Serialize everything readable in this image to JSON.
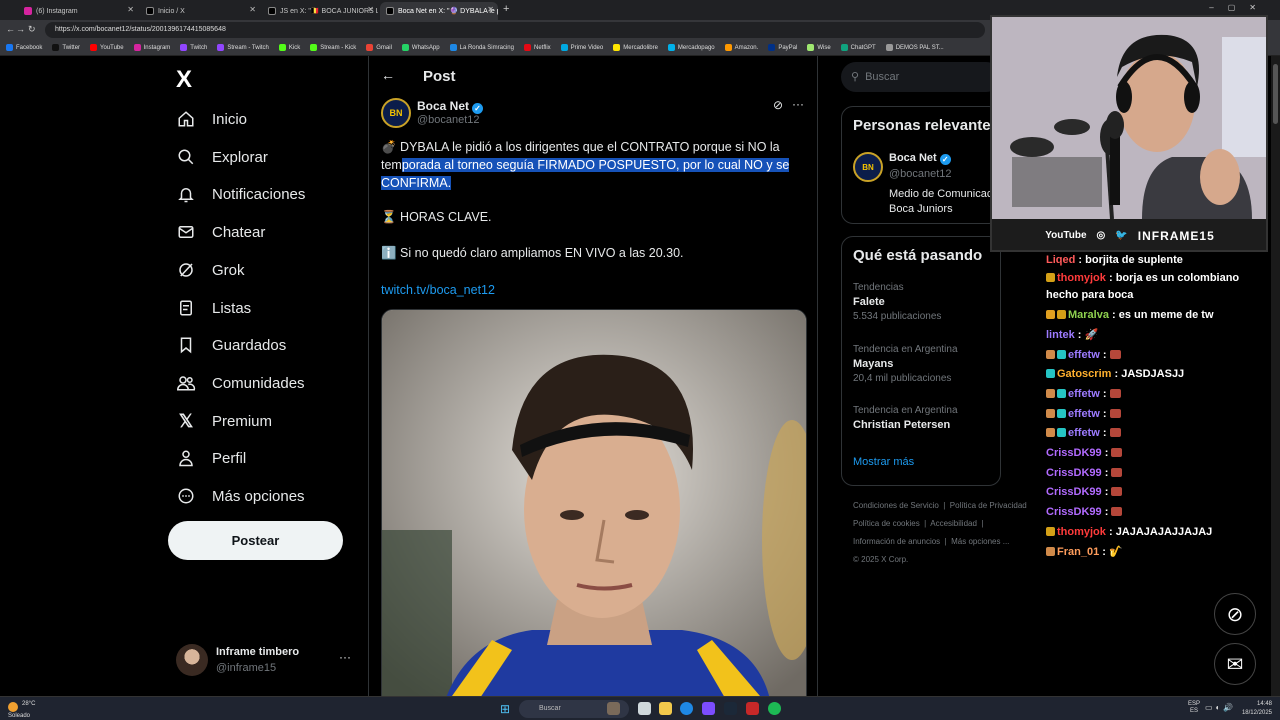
{
  "browser": {
    "tabs": [
      {
        "title": "(6) Instagram",
        "active": false
      },
      {
        "title": "Inicio / X",
        "active": false
      },
      {
        "title": "JS en X: \"🇧🇪 BOCA JUNIORS LE...",
        "active": false
      },
      {
        "title": "Boca Net en X: \"🔮 DYBALA le pi...",
        "active": true
      }
    ],
    "url": "https://x.com/bocanet12/status/2001396174415085648",
    "bookmarks": [
      "Facebook",
      "Twitter",
      "YouTube",
      "Instagram",
      "Twitch",
      "Stream - Twitch",
      "Kick",
      "Stream - Kick",
      "Gmail",
      "WhatsApp",
      "La Ronda Simracing",
      "Netflix",
      "Prime Video",
      "Mercadolibre",
      "Mercadopago",
      "Amazon.",
      "PayPal",
      "Wise",
      "ChatGPT",
      "DEMOS PAL ST..."
    ]
  },
  "nav": {
    "logo": "X",
    "items": [
      {
        "label": "Inicio",
        "icon": "home-icon"
      },
      {
        "label": "Explorar",
        "icon": "search-icon"
      },
      {
        "label": "Notificaciones",
        "icon": "bell-icon"
      },
      {
        "label": "Chatear",
        "icon": "mail-icon"
      },
      {
        "label": "Grok",
        "icon": "grok-icon"
      },
      {
        "label": "Listas",
        "icon": "list-icon"
      },
      {
        "label": "Guardados",
        "icon": "bookmark-icon"
      },
      {
        "label": "Comunidades",
        "icon": "people-icon"
      },
      {
        "label": "Premium",
        "icon": "x-icon"
      },
      {
        "label": "Perfil",
        "icon": "user-icon"
      },
      {
        "label": "Más opciones",
        "icon": "more-circle-icon"
      }
    ],
    "post_button": "Postear",
    "profile": {
      "name": "Inframe timbero",
      "handle": "@inframe15",
      "more": "···"
    }
  },
  "post": {
    "header_title": "Post",
    "author_name": "Boca Net",
    "author_handle": "@bocanet12",
    "text_line1_pre": "💣 DYBALA le pidió a los dirigentes que el CONTRATO porque si NO la tem",
    "text_line1_hl": "porada al torneo seguía FIRMADO POSPUESTO, por lo cual NO y se CONFIRMA.",
    "line2": "⏳ HORAS CLAVE.",
    "line3": "ℹ️ Si no quedó claro ampliamos EN VIVO a las 20.30.",
    "link": "twitch.tv/boca_net12"
  },
  "right": {
    "search_placeholder": "Buscar",
    "relevant_title": "Personas relevantes",
    "relevant_person": {
      "name": "Boca Net",
      "handle": "@bocanet12",
      "bio": "Medio de Comunicación del Club Atlético Boca Juniors"
    },
    "trending_title": "Qué está pasando",
    "trends": [
      {
        "context": "Tendencias",
        "name": "Falete",
        "count": "5.534 publicaciones"
      },
      {
        "context": "Tendencia en Argentina",
        "name": "Mayans",
        "count": "20,4 mil publicaciones"
      },
      {
        "context": "Tendencia en Argentina",
        "name": "Christian Petersen",
        "count": ""
      }
    ],
    "show_more": "Mostrar más",
    "footer": [
      "Condiciones de Servicio",
      "Política de Privacidad",
      "Política de cookies",
      "Accesibilidad",
      "Información de anuncios",
      "Más opciones ...",
      "© 2025 X Corp."
    ]
  },
  "webcam": {
    "youtube": "YouTube",
    "brand": "INFRAME15"
  },
  "chat": [
    {
      "user": "Liqed",
      "color": "#ff5a5a",
      "text": "borjita de suplente",
      "badges": []
    },
    {
      "user": "thomyjok",
      "color": "#ff3b3b",
      "text": "borja es un colombiano hecho para boca",
      "badges": [
        "#d4a017"
      ]
    },
    {
      "user": "Maralva",
      "color": "#8fd14f",
      "text": "es un meme de tw",
      "badges": [
        "#e0a020",
        "#d4a017"
      ]
    },
    {
      "user": "lintek",
      "color": "#9d7bff",
      "text": "🚀",
      "badges": []
    },
    {
      "user": "effetw",
      "color": "#9d7bff",
      "text": "",
      "badges": [
        "#d08a4a",
        "#25c4c4"
      ],
      "emote": true
    },
    {
      "user": "Gatoscrim",
      "color": "#ffb02e",
      "text": "JASDJASJJ",
      "badges": [
        "#25c4c4"
      ]
    },
    {
      "user": "effetw",
      "color": "#9d7bff",
      "text": "",
      "badges": [
        "#d08a4a",
        "#25c4c4"
      ],
      "emote": true
    },
    {
      "user": "effetw",
      "color": "#9d7bff",
      "text": "",
      "badges": [
        "#d08a4a",
        "#25c4c4"
      ],
      "emote": true
    },
    {
      "user": "effetw",
      "color": "#9d7bff",
      "text": "",
      "badges": [
        "#d08a4a",
        "#25c4c4"
      ],
      "emote": true
    },
    {
      "user": "CrissDK99",
      "color": "#b26bff",
      "text": "",
      "badges": [],
      "emote": true
    },
    {
      "user": "CrissDK99",
      "color": "#b26bff",
      "text": "",
      "badges": [],
      "emote": true
    },
    {
      "user": "CrissDK99",
      "color": "#b26bff",
      "text": "",
      "badges": [],
      "emote": true
    },
    {
      "user": "CrissDK99",
      "color": "#b26bff",
      "text": "",
      "badges": [],
      "emote": true
    },
    {
      "user": "thomyjok",
      "color": "#ff3b3b",
      "text": "JAJAJAJAJJAJAJ",
      "badges": [
        "#d4a017"
      ]
    },
    {
      "user": "Fran_01",
      "color": "#ff9d5c",
      "text": "🎷",
      "badges": [
        "#d08a4a"
      ]
    }
  ],
  "taskbar": {
    "weather_temp": "28°C",
    "weather_desc": "Soleado",
    "search": "Buscar",
    "lang_top": "ESP",
    "lang_bottom": "ES",
    "time": "14:48",
    "date": "18/12/2025"
  },
  "colors": {
    "accent": "#1d9bf0",
    "highlight": "#1652b8",
    "bg": "#000000"
  }
}
